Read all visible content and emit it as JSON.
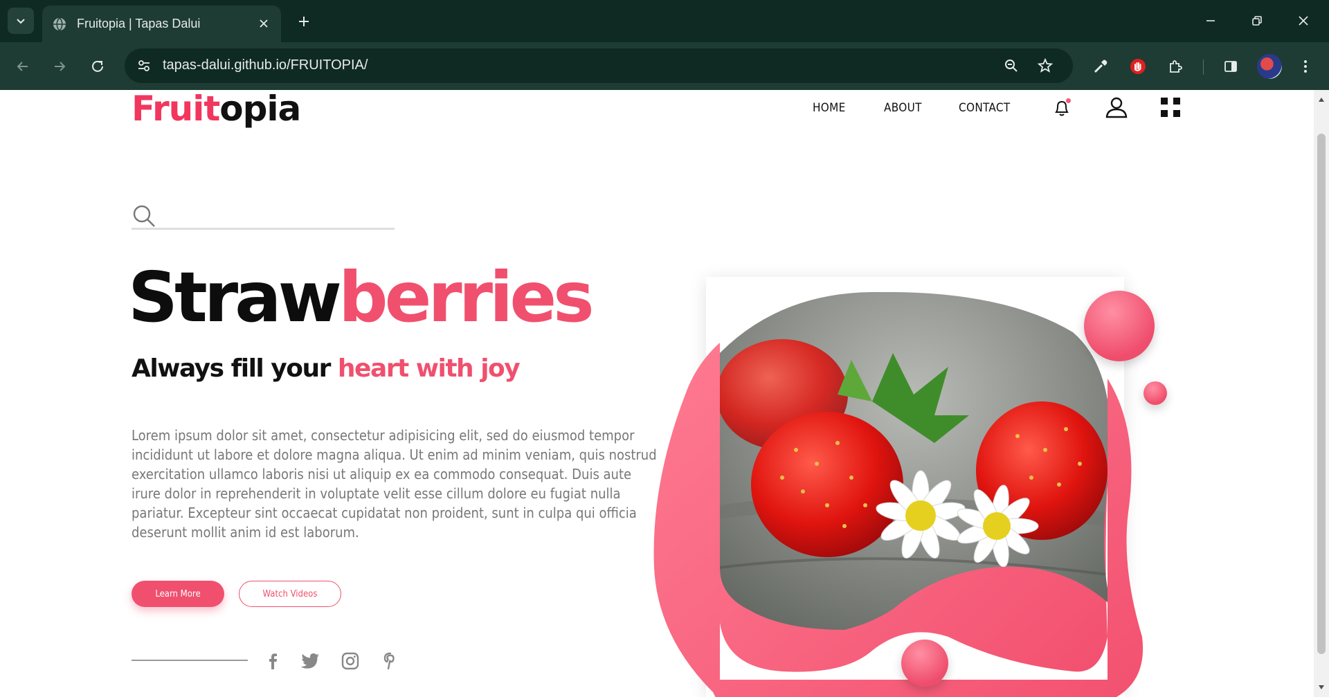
{
  "browser": {
    "tab_title": "Fruitopia | Tapas Dalui",
    "url": "tapas-dalui.github.io/FRUITOPIA/"
  },
  "site": {
    "logo_part1": "Fruit",
    "logo_part2": "opia",
    "nav": [
      "HOME",
      "ABOUT",
      "CONTACT"
    ],
    "search_placeholder": ""
  },
  "hero": {
    "title_part1": "Straw",
    "title_part2": "berries",
    "subtitle_part1": "Always fill your ",
    "subtitle_part2": "heart with joy",
    "description": "Lorem ipsum dolor sit amet, consectetur adipisicing elit, sed do eiusmod tempor incididunt ut labore et dolore magna aliqua. Ut enim ad minim veniam, quis nostrud exercitation ullamco laboris nisi ut aliquip ex ea commodo consequat. Duis aute irure dolor in reprehenderit in voluptate velit esse cillum dolore eu fugiat nulla pariatur. Excepteur sint occaecat cupidatat non proident, sunt in culpa qui officia deserunt mollit anim id est laborum.",
    "learn_more": "Learn More",
    "watch_videos": "Watch Videos"
  },
  "social": [
    "facebook-icon",
    "twitter-icon",
    "instagram-icon",
    "pinterest-icon"
  ],
  "colors": {
    "accent": "#f0506e",
    "logo_accent": "#f1375e",
    "chrome_dark": "#0f2a22",
    "chrome_toolbar": "#1e3c33"
  }
}
